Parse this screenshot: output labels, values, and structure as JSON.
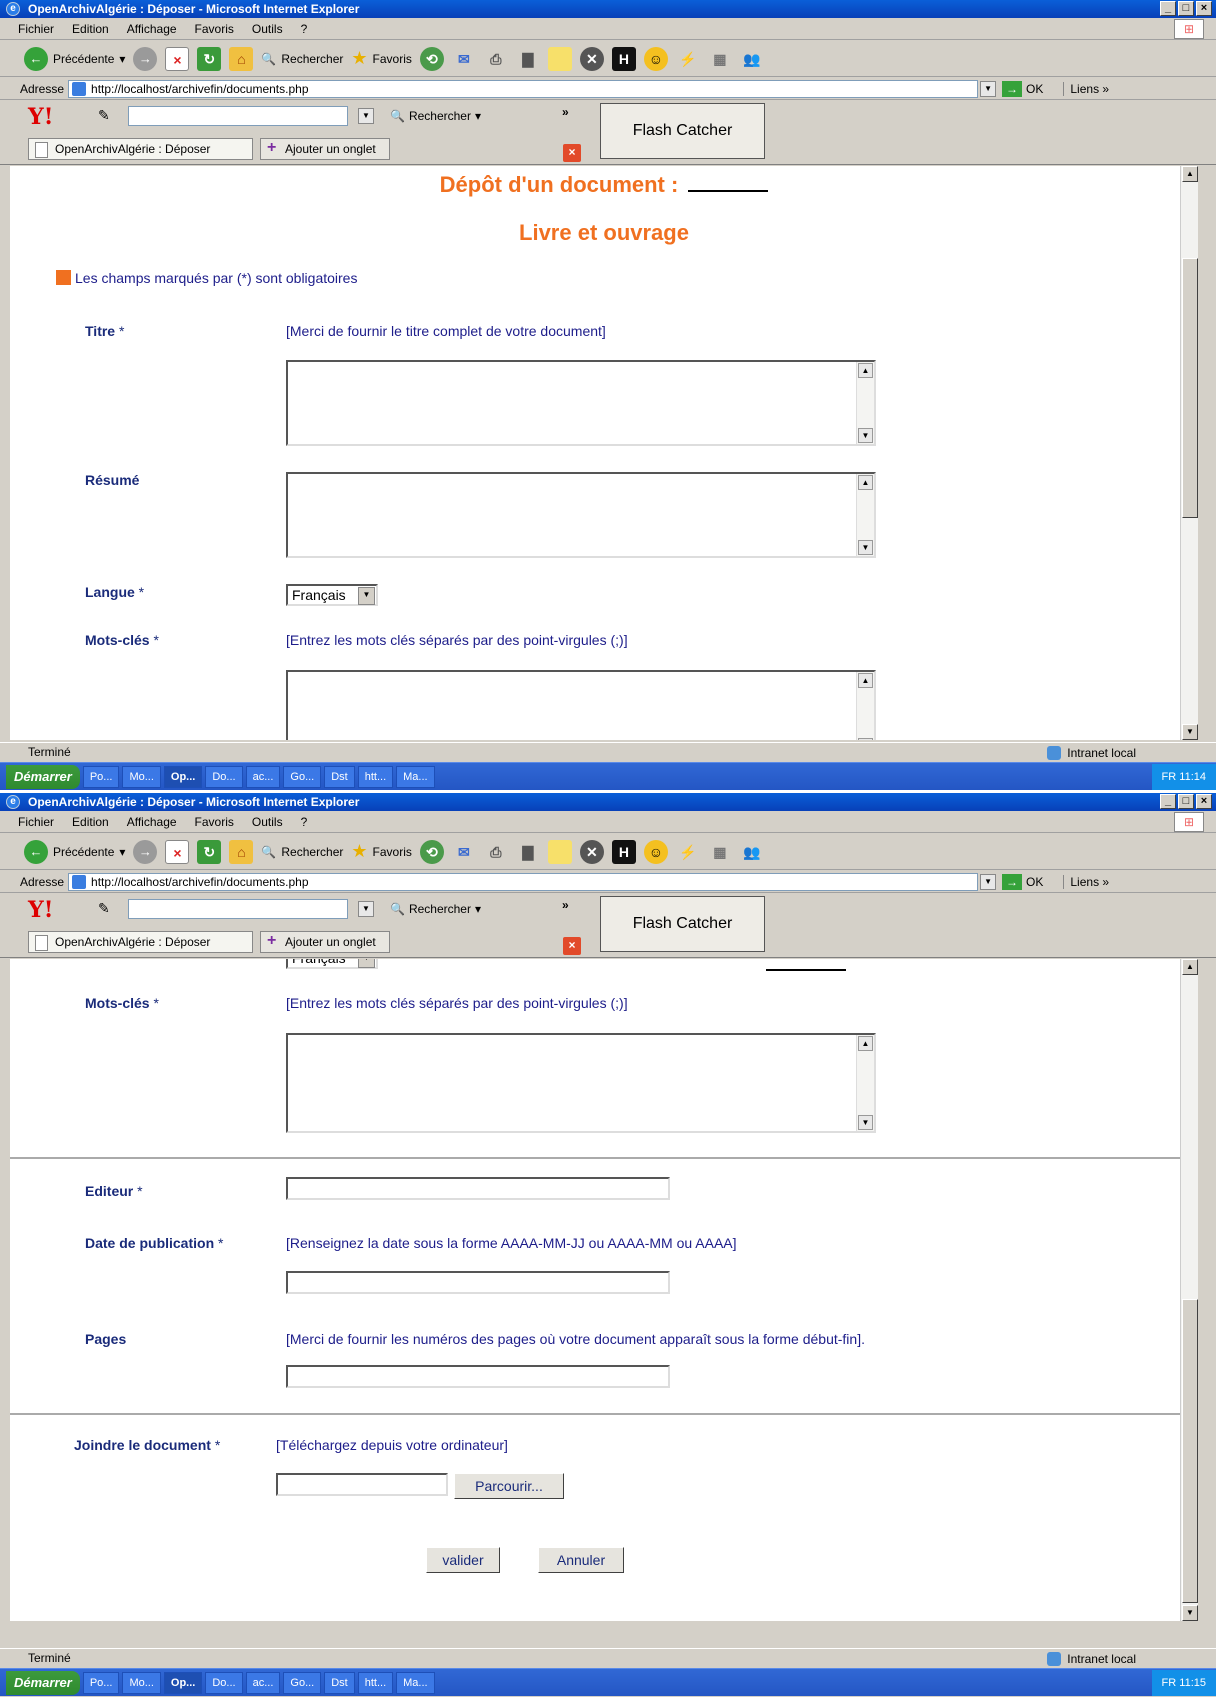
{
  "window": {
    "title": "OpenArchivAlgérie : Déposer - Microsoft Internet Explorer",
    "controls": [
      "_",
      "□",
      "×"
    ]
  },
  "menu": [
    "Fichier",
    "Edition",
    "Affichage",
    "Favoris",
    "Outils",
    "?"
  ],
  "toolbar": {
    "back_label": "Précédente",
    "search_label": "Rechercher",
    "favorites_label": "Favoris"
  },
  "address": {
    "label": "Adresse",
    "url": "http://localhost/archivefin/documents.php",
    "go_label": "OK",
    "links_label": "Liens"
  },
  "yahoo": {
    "search_button": "Rechercher",
    "flash_catcher": "Flash Catcher"
  },
  "tabs": {
    "active_tab": "OpenArchivAlgérie : Déposer",
    "new_tab": "Ajouter un onglet"
  },
  "status": {
    "text": "Terminé",
    "zone": "Intranet local"
  },
  "taskbar": {
    "start": "Démarrer",
    "items": [
      "Po...",
      "Mo...",
      "Op...",
      "Do...",
      "ac...",
      "Go...",
      "Dst",
      "htt...",
      "Ma..."
    ],
    "clock_1": "11:14",
    "clock_2": "11:15",
    "lang": "FR"
  },
  "form": {
    "heading": "Dépôt d'un document :",
    "subheading": "Livre et ouvrage",
    "required_note": "Les champs marqués par (*) sont obligatoires",
    "titre_label": "Titre",
    "titre_hint": "[Merci de fournir le titre complet de votre document]",
    "resume_label": "Résumé",
    "langue_label": "Langue",
    "langue_value": "Français",
    "mots_label": "Mots-clés",
    "mots_hint": "[Entrez les mots clés séparés par des point-virgules (;)]",
    "editeur_label": "Editeur",
    "date_label": "Date de publication",
    "date_hint": "[Renseignez la date sous la forme AAAA-MM-JJ ou AAAA-MM ou AAAA]",
    "pages_label": "Pages",
    "pages_hint": "[Merci de fournir les numéros des pages où votre document apparaît sous la forme début-fin].",
    "joindre_label": "Joindre le document",
    "joindre_hint": "[Téléchargez depuis votre ordinateur]",
    "browse_button": "Parcourir...",
    "submit_button": "valider",
    "cancel_button": "Annuler",
    "required_mark": "*"
  },
  "colors": {
    "accent": "#f07020",
    "label": "#1a2b7a",
    "titlebar": "#0a5fd8"
  }
}
